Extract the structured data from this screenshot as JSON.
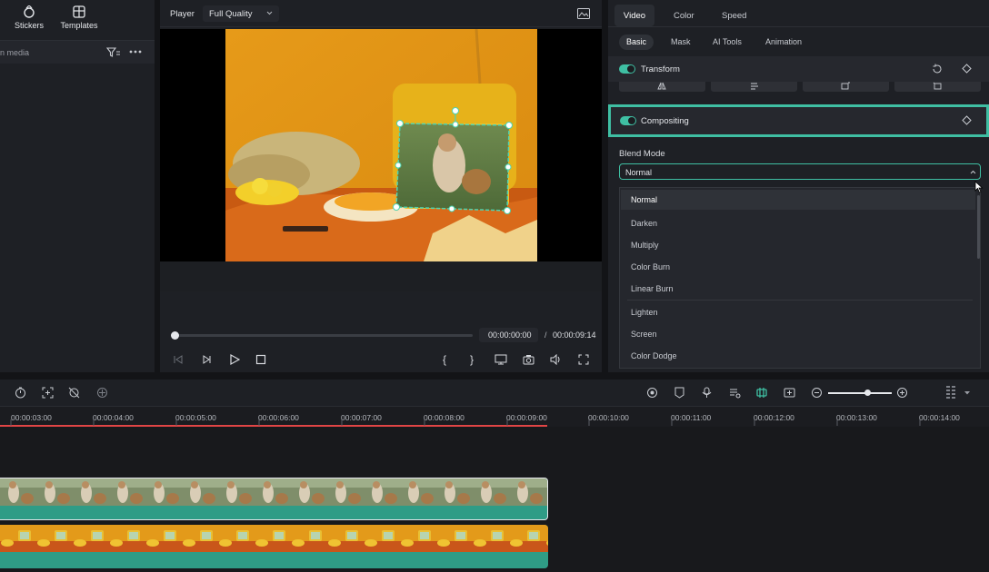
{
  "left_panel": {
    "tabs": [
      {
        "label": "Stickers",
        "icon": "stickers-icon"
      },
      {
        "label": "Templates",
        "icon": "templates-icon"
      }
    ],
    "bar_text": "n media"
  },
  "player": {
    "label": "Player",
    "quality": "Full Quality",
    "current_time": "00:00:00:00",
    "separator": "/",
    "total_time": "00:00:09:14"
  },
  "right_panel": {
    "tabs": [
      "Video",
      "Color",
      "Speed"
    ],
    "active_tab": "Video",
    "subtabs": [
      "Basic",
      "Mask",
      "AI Tools",
      "Animation"
    ],
    "active_subtab": "Basic",
    "transform_label": "Transform",
    "compositing_label": "Compositing",
    "blend_mode_label": "Blend Mode",
    "blend_mode_value": "Normal",
    "blend_options": [
      "Normal",
      "Darken",
      "Multiply",
      "Color Burn",
      "Linear Burn",
      "Lighten",
      "Screen",
      "Color Dodge"
    ]
  },
  "timeline": {
    "ticks": [
      "00:00:03:00",
      "00:00:04:00",
      "00:00:05:00",
      "00:00:06:00",
      "00:00:07:00",
      "00:00:08:00",
      "00:00:09:00",
      "00:00:10:00",
      "00:00:11:00",
      "00:00:12:00",
      "00:00:13:00",
      "00:00:14:00"
    ]
  },
  "colors": {
    "accent": "#3fbfa3",
    "playhead": "#e14545",
    "panel": "#1e2025",
    "clip": "#2f9c86"
  }
}
